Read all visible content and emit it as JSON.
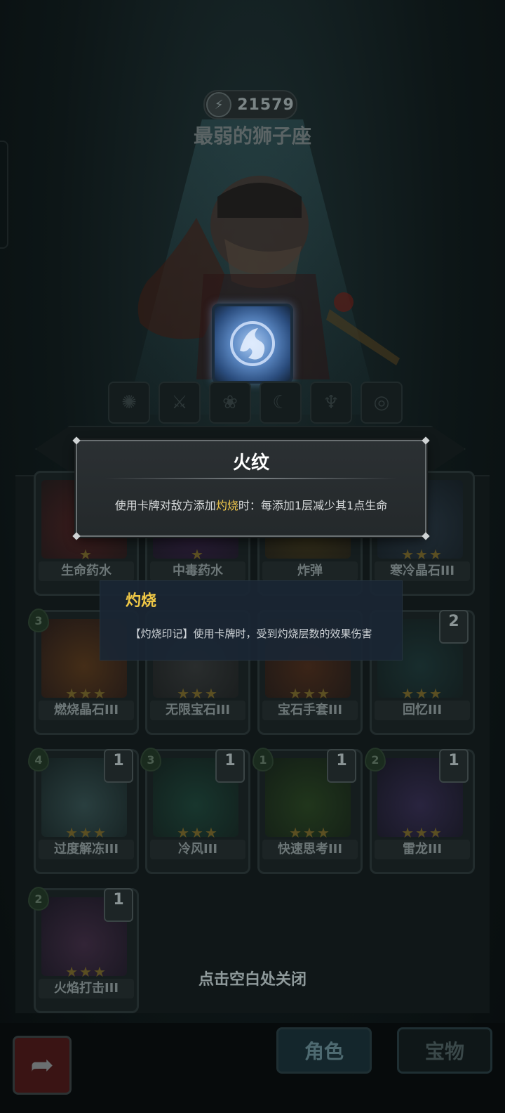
{
  "player": {
    "score": "21579",
    "title": "最弱的狮子座"
  },
  "tooltip": {
    "title": "火纹",
    "desc_before": "使用卡牌对敌方添加",
    "desc_keyword": "灼烧",
    "desc_after": "时：每添加1层减少其1点生命"
  },
  "subtip": {
    "title": "灼烧",
    "desc": "【灼烧印记】使用卡牌时，受到灼烧层数的效果伤害"
  },
  "cards": [
    {
      "name": "生命药水",
      "stars": "★",
      "cost": "",
      "count": ""
    },
    {
      "name": "中毒药水",
      "stars": "★",
      "cost": "",
      "count": ""
    },
    {
      "name": "炸弹",
      "stars": "",
      "cost": "",
      "count": ""
    },
    {
      "name": "寒冷晶石III",
      "stars": "★★★",
      "cost": "",
      "count": ""
    },
    {
      "name": "燃烧晶石III",
      "stars": "★★★",
      "cost": "3",
      "count": ""
    },
    {
      "name": "无限宝石III",
      "stars": "★★★",
      "cost": "",
      "count": ""
    },
    {
      "name": "宝石手套III",
      "stars": "★★★",
      "cost": "",
      "count": ""
    },
    {
      "name": "回忆III",
      "stars": "★★★",
      "cost": "",
      "count": "2"
    },
    {
      "name": "过度解冻III",
      "stars": "★★★",
      "cost": "4",
      "count": "1"
    },
    {
      "name": "冷风III",
      "stars": "★★★",
      "cost": "3",
      "count": "1"
    },
    {
      "name": "快速思考III",
      "stars": "★★★",
      "cost": "1",
      "count": "1"
    },
    {
      "name": "雷龙III",
      "stars": "★★★",
      "cost": "2",
      "count": "1"
    },
    {
      "name": "火焰打击III",
      "stars": "★★★",
      "cost": "2",
      "count": "1"
    }
  ],
  "close_hint": "点击空白处关闭",
  "tabs": {
    "role": "角色",
    "treasure": "宝物"
  },
  "colors": {
    "keyword": "#f2c94c",
    "subtip_title": "#f0c846"
  }
}
